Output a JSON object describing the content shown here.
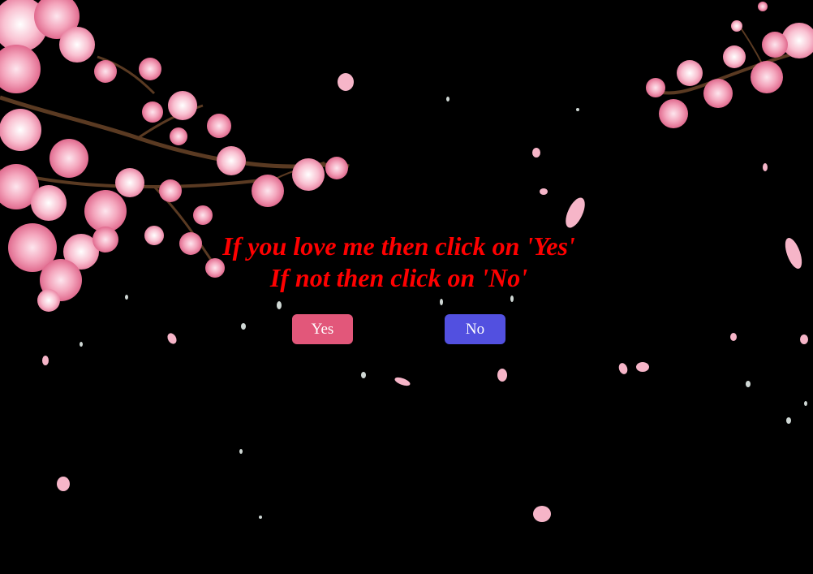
{
  "prompt": {
    "line1": "If you love me then click on 'Yes'",
    "line2": "If not then click on 'No'"
  },
  "buttons": {
    "yes_label": "Yes",
    "no_label": "No"
  },
  "colors": {
    "background": "#000000",
    "prompt_text": "#ff0000",
    "yes_button": "#e2577a",
    "no_button": "#5250e0",
    "blossom": "#f4a6bd",
    "blossom_light": "#fbd3df",
    "blossom_dark": "#e06a8e",
    "branch": "#5a3a22"
  },
  "background_image": "cherry-blossom-branches-with-falling-petals"
}
